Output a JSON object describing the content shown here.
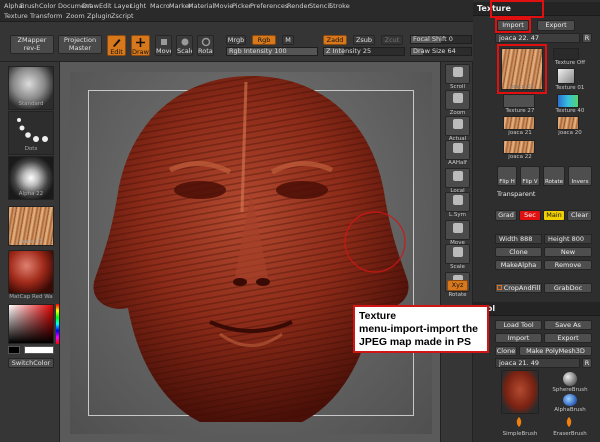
{
  "menubar": {
    "row1": [
      "Alpha",
      "Brush",
      "Color",
      "Document",
      "Draw",
      "Edit",
      "Layer",
      "Light",
      "Macro",
      "Marker",
      "Material",
      "Movie",
      "Picker",
      "Preferences",
      "Render",
      "Stencil",
      "Stroke"
    ],
    "row2": [
      "Texture",
      "Transform",
      "Zoom",
      "Zplugin",
      "Zscript"
    ]
  },
  "shelf": {
    "zmapper_label": "ZMapper",
    "zmapper_sub": "rev-E",
    "projection_label": "Projection",
    "projection_sub": "Master",
    "edit_label": "Edit",
    "draw_label": "Draw",
    "move_label": "Move",
    "scale_label": "Scale",
    "rotate_label": "Rotate",
    "mrgb_label": "Mrgb",
    "rgb_label": "Rgb",
    "m_label": "M",
    "rgb_intensity_label": "Rgb Intensity",
    "rgb_intensity_value": "100",
    "zadd_label": "Zadd",
    "zsub_label": "Zsub",
    "zcut_label": "Zcut",
    "z_intensity_label": "Z Intensity",
    "z_intensity_value": "25",
    "focal_shift_label": "Focal Shift",
    "focal_shift_value": "0",
    "draw_size_label": "Draw Size",
    "draw_size_value": "64"
  },
  "left": {
    "standard": "Standard",
    "dots": "Dots",
    "alpha_label": "Alpha 22",
    "texture_label": "joaca 22",
    "material_label": "MatCap Red Wa",
    "switch_color": "SwitchColor"
  },
  "tools": [
    {
      "label": "Scroll",
      "icon": "hand-icon"
    },
    {
      "label": "Zoom",
      "icon": "magnifier-icon"
    },
    {
      "label": "Actual",
      "icon": "actual-icon"
    },
    {
      "label": "AAHalf",
      "icon": "aahalf-icon"
    },
    {
      "label": "Local",
      "icon": "local-icon"
    },
    {
      "label": "L.Sym",
      "icon": "lsym-icon"
    },
    {
      "label": "Move",
      "icon": "move-icon"
    },
    {
      "label": "Scale",
      "icon": "scale-icon"
    },
    {
      "label": "Rotate",
      "icon": "rotate-icon"
    },
    {
      "label": "Lasso",
      "icon": "lasso-icon"
    }
  ],
  "tools_xyz": "Xyz",
  "texture": {
    "title": "Texture",
    "import_label": "Import",
    "export_label": "Export",
    "current_slider": "joaca 22. 47",
    "r_label": "R",
    "texture_off": "Texture Off",
    "t01": "Texture 01",
    "t27": "Texture 27",
    "t40": "Texture 40",
    "j21": "joaca 21",
    "j20": "joaca 20",
    "j22": "joaca 22",
    "main_caption": "joaca 22",
    "fliph": "Flip H",
    "flipv": "Flip V",
    "rotate": "Rotate",
    "invers": "Invers",
    "transparent": "Transparent",
    "grad": "Grad",
    "sec": "Sec",
    "main": "Main",
    "clear": "Clear",
    "width_label": "Width",
    "width_value": "888",
    "height_label": "Height",
    "height_value": "800",
    "clone": "Clone",
    "new": "New",
    "makealpha": "MakeAlpha",
    "remove": "Remove",
    "cropandfill": "CropAndFill",
    "grabdoc": "GrabDoc"
  },
  "tool": {
    "title": "Tool",
    "load_tool": "Load Tool",
    "save_as": "Save As",
    "import": "Import",
    "export": "Export",
    "clone": "Clone",
    "make_polymesh": "Make PolyMesh3D",
    "current_slider": "joaca 21. 49",
    "r_label": "R",
    "sphere_brush": "SphereBrush",
    "alpha_brush": "AlphaBrush",
    "simple_brush": "SimpleBrush",
    "eraser_brush": "EraserBrush"
  },
  "annotation": {
    "line1": "Texture",
    "line2": "menu-import-import the",
    "line3": "JPEG map made in PS"
  },
  "colors": {
    "accent_orange": "#d8781c",
    "annotation_red": "#e01010",
    "wood_red": "#8a2a18"
  }
}
